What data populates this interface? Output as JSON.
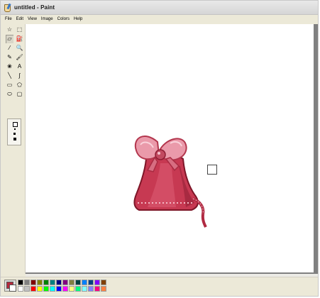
{
  "window": {
    "title": "untitled - Paint",
    "background": "#ece9d8"
  },
  "menu": {
    "items": [
      "File",
      "Edit",
      "View",
      "Image",
      "Colors",
      "Help"
    ]
  },
  "toolbox": {
    "tools": [
      {
        "name": "free-form-select",
        "glyph": "☆"
      },
      {
        "name": "rect-select",
        "glyph": "⬚"
      },
      {
        "name": "eraser",
        "glyph": "▱"
      },
      {
        "name": "fill",
        "glyph": "⛽"
      },
      {
        "name": "color-picker",
        "glyph": "⁄"
      },
      {
        "name": "magnifier",
        "glyph": "🔍"
      },
      {
        "name": "pencil",
        "glyph": "✎"
      },
      {
        "name": "brush",
        "glyph": "🖌"
      },
      {
        "name": "airbrush",
        "glyph": "❀"
      },
      {
        "name": "text",
        "glyph": "A"
      },
      {
        "name": "line",
        "glyph": "╲"
      },
      {
        "name": "curve",
        "glyph": "∫"
      },
      {
        "name": "rectangle",
        "glyph": "▭"
      },
      {
        "name": "polygon",
        "glyph": "⬠"
      },
      {
        "name": "ellipse",
        "glyph": "⬭"
      },
      {
        "name": "rounded-rectangle",
        "glyph": "▢"
      }
    ],
    "selected_tool": "eraser"
  },
  "canvas": {
    "background": "#ffffff",
    "workspace_color": "#808080"
  },
  "colors": {
    "foreground": "#b5283c",
    "background": "#ffffff",
    "palette": [
      "#000000",
      "#808080",
      "#800000",
      "#808000",
      "#008000",
      "#008080",
      "#000080",
      "#800080",
      "#808040",
      "#004040",
      "#0080ff",
      "#004080",
      "#8000ff",
      "#804000",
      "#ffffff",
      "#c0c0c0",
      "#ff0000",
      "#ffff00",
      "#00ff00",
      "#00ffff",
      "#0000ff",
      "#ff00ff",
      "#ffff80",
      "#00ff80",
      "#80ffff",
      "#8080ff",
      "#ff0080",
      "#ff8040"
    ]
  }
}
